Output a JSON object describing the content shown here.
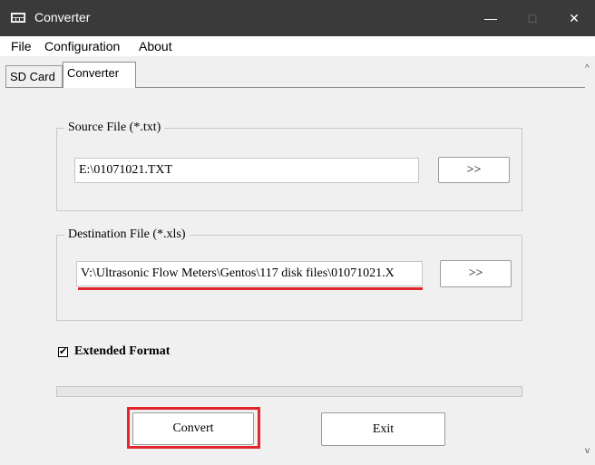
{
  "window": {
    "title": "Converter",
    "minimize": "—",
    "maximize": "□",
    "close": "✕"
  },
  "menu": [
    "File",
    "Configuration",
    "About"
  ],
  "tabs": [
    {
      "label": "SD Card",
      "active": false
    },
    {
      "label": "Converter",
      "active": true
    }
  ],
  "source": {
    "legend": "Source File (*.txt)",
    "value": "E:\\01071021.TXT",
    "browse_label": ">>"
  },
  "destination": {
    "legend": "Destination File (*.xls)",
    "value": "V:\\Ultrasonic Flow Meters\\Gentos\\117 disk files\\01071021.X",
    "browse_label": ">>"
  },
  "extended_format": {
    "label": "Extended Format",
    "checked": true,
    "check_mark": "✔"
  },
  "progress": {
    "fraction": 0
  },
  "buttons": {
    "convert": "Convert",
    "exit": "Exit"
  },
  "scrollbar": {
    "up": "^",
    "down": "v"
  },
  "colors": {
    "titlebar": "#3a3a3a",
    "annotation_red": "#e0262f"
  }
}
